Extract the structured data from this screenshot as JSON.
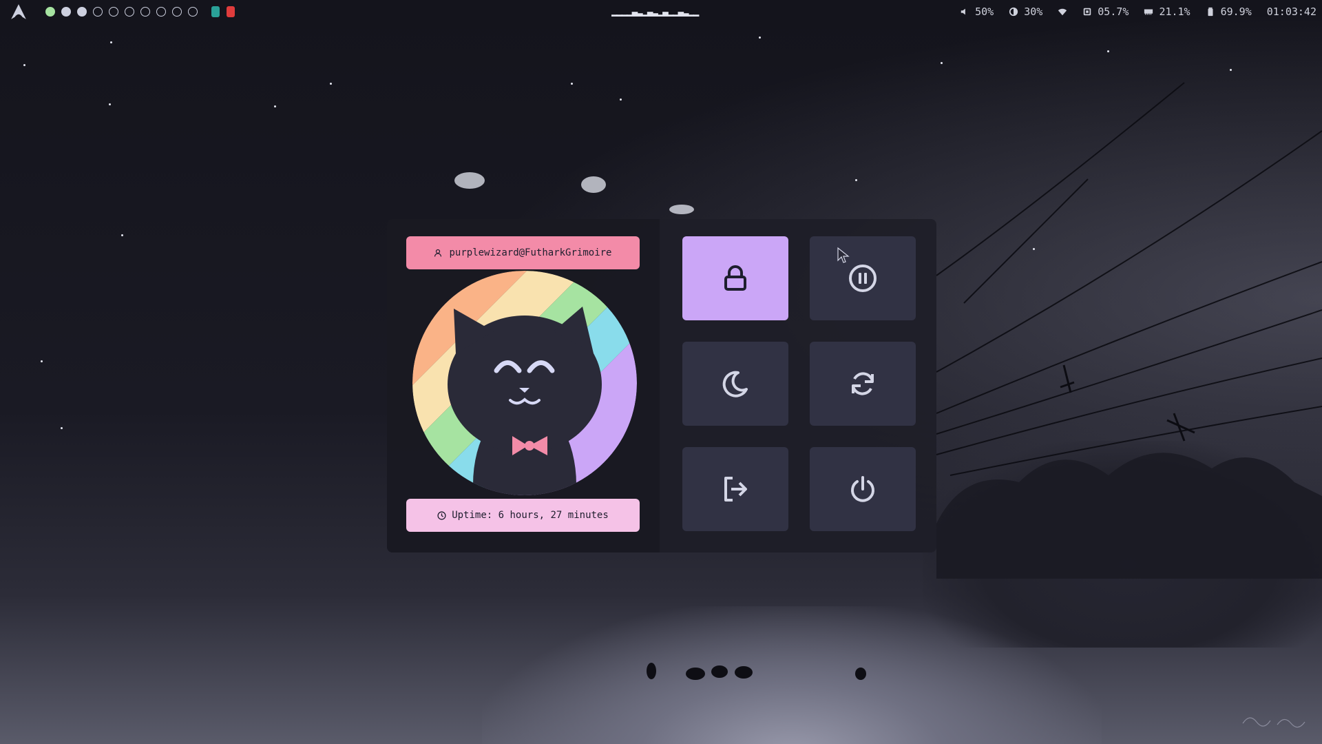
{
  "topbar": {
    "logo_icon": "arch-linux-icon",
    "workspaces": [
      {
        "state": "active",
        "color": "#a6e3a1"
      },
      {
        "state": "occupied",
        "color": "#cdd0df"
      },
      {
        "state": "occupied",
        "color": "#cdd0df"
      },
      {
        "state": "empty"
      },
      {
        "state": "empty"
      },
      {
        "state": "empty"
      },
      {
        "state": "empty"
      },
      {
        "state": "empty"
      },
      {
        "state": "empty"
      },
      {
        "state": "empty"
      }
    ],
    "tray_apps": [
      {
        "icon": "app-green-icon",
        "color": "#2aa198"
      },
      {
        "icon": "app-red-icon",
        "color": "#e03c3c"
      }
    ],
    "window_title": "▂▂▂▂▄▃▂▄▃▂▄▂▂▄▃▂▂",
    "status": {
      "volume": "50%",
      "brightness": "30%",
      "cpu": "05.7%",
      "memory": "21.1%",
      "battery": "69.9%",
      "clock": "01:03:42"
    }
  },
  "powermenu": {
    "user": "purplewizard@FutharkGrimoire",
    "uptime": "Uptime: 6 hours, 27 minutes",
    "buttons": [
      {
        "name": "lock",
        "icon": "lock-icon",
        "selected": true
      },
      {
        "name": "suspend",
        "icon": "pause-circle-icon",
        "selected": false
      },
      {
        "name": "hibernate",
        "icon": "moon-icon",
        "selected": false
      },
      {
        "name": "reboot",
        "icon": "refresh-icon",
        "selected": false
      },
      {
        "name": "logout",
        "icon": "logout-icon",
        "selected": false
      },
      {
        "name": "shutdown",
        "icon": "power-icon",
        "selected": false
      }
    ]
  },
  "colors": {
    "accent_pink": "#f38ba8",
    "accent_light_pink": "#f5c2e7",
    "accent_purple": "#cba6f7",
    "button_bg": "#313244",
    "panel_bg": "#1e1e28"
  }
}
